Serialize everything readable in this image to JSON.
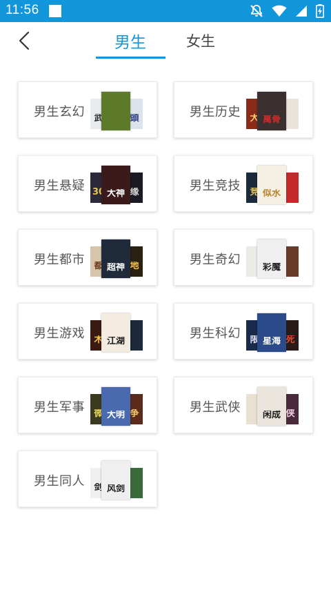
{
  "status_bar": {
    "time": "11:56",
    "icons": [
      "notification-square-icon",
      "notifications-off-icon",
      "wifi-icon",
      "signal-icon",
      "battery-charging-icon"
    ]
  },
  "nav": {
    "back_icon": "chevron-left-icon",
    "tabs": [
      {
        "label": "男生",
        "active": true
      },
      {
        "label": "女生",
        "active": false
      }
    ]
  },
  "colors": {
    "accent": "#1296db",
    "label": "#555555",
    "card_border": "#ececec"
  },
  "categories": [
    {
      "label": "男生玄幻",
      "covers": [
        {
          "bg": "#e9ecef",
          "fg": "#2a2a2a",
          "title": "武"
        },
        {
          "bg": "#5d7a2a",
          "fg": "#0f2a08",
          "title": " "
        },
        {
          "bg": "#dce3ea",
          "fg": "#2f3d8a",
          "title": "頭"
        }
      ]
    },
    {
      "label": "男生历史",
      "covers": [
        {
          "bg": "#8a2a18",
          "fg": "#f5d06a",
          "title": "大"
        },
        {
          "bg": "#3a3030",
          "fg": "#d42a2a",
          "title": "萬骨"
        },
        {
          "bg": "#e8e4dc",
          "fg": "#333",
          "title": " "
        }
      ]
    },
    {
      "label": "男生悬疑",
      "covers": [
        {
          "bg": "#2a2a3a",
          "fg": "#e8c55a",
          "title": "30"
        },
        {
          "bg": "#3a1a1a",
          "fg": "#ffffff",
          "title": "大神"
        },
        {
          "bg": "#1a1a22",
          "fg": "#d8d8d8",
          "title": "缘"
        }
      ]
    },
    {
      "label": "男生竞技",
      "covers": [
        {
          "bg": "#1a2a3a",
          "fg": "#e8c55a",
          "title": "竞"
        },
        {
          "bg": "#f4f0e4",
          "fg": "#b8822a",
          "title": "似水"
        },
        {
          "bg": "#c42a2a",
          "fg": "#ffffff",
          "title": " "
        }
      ]
    },
    {
      "label": "男生都市",
      "covers": [
        {
          "bg": "#d8c4a8",
          "fg": "#6a3a1a",
          "title": "都"
        },
        {
          "bg": "#1f2a3a",
          "fg": "#ffffff",
          "title": "超神"
        },
        {
          "bg": "#2a2010",
          "fg": "#f5c24a",
          "title": "地"
        }
      ]
    },
    {
      "label": "男生奇幻",
      "covers": [
        {
          "bg": "#ecebe6",
          "fg": "#444",
          "title": " "
        },
        {
          "bg": "#efefef",
          "fg": "#222",
          "title": "彩魔"
        },
        {
          "bg": "#6a3a2a",
          "fg": "#f0d8b0",
          "title": " "
        }
      ]
    },
    {
      "label": "男生游戏",
      "covers": [
        {
          "bg": "#3a1a10",
          "fg": "#f5c24a",
          "title": "木"
        },
        {
          "bg": "#f4ece0",
          "fg": "#1a1a1a",
          "title": "江湖"
        },
        {
          "bg": "#1a2a3a",
          "fg": "#cfd8e0",
          "title": " "
        }
      ]
    },
    {
      "label": "男生科幻",
      "covers": [
        {
          "bg": "#1a2a4a",
          "fg": "#e8e8ff",
          "title": "限"
        },
        {
          "bg": "#2a4a8a",
          "fg": "#ffffff",
          "title": "星海"
        },
        {
          "bg": "#2a1a1a",
          "fg": "#e84a2a",
          "title": "死"
        }
      ]
    },
    {
      "label": "男生军事",
      "covers": [
        {
          "bg": "#3a3a20",
          "fg": "#e8d85a",
          "title": "微"
        },
        {
          "bg": "#4a6ab0",
          "fg": "#ffffff",
          "title": "大明"
        },
        {
          "bg": "#5a2a1a",
          "fg": "#f0c26a",
          "title": "争"
        }
      ]
    },
    {
      "label": "男生武侠",
      "covers": [
        {
          "bg": "#e8e0d0",
          "fg": "#444",
          "title": " "
        },
        {
          "bg": "#e9e5dc",
          "fg": "#1a1a1a",
          "title": "闲成"
        },
        {
          "bg": "#4a2a3a",
          "fg": "#f0d0e0",
          "title": "侠"
        }
      ]
    },
    {
      "label": "男生同人",
      "covers": [
        {
          "bg": "#f0f0f0",
          "fg": "#1a1a1a",
          "title": "剑"
        },
        {
          "bg": "#efefef",
          "fg": "#1a1a1a",
          "title": "风剑"
        },
        {
          "bg": "#3a6a3a",
          "fg": "#e0f0d0",
          "title": " "
        }
      ]
    }
  ]
}
